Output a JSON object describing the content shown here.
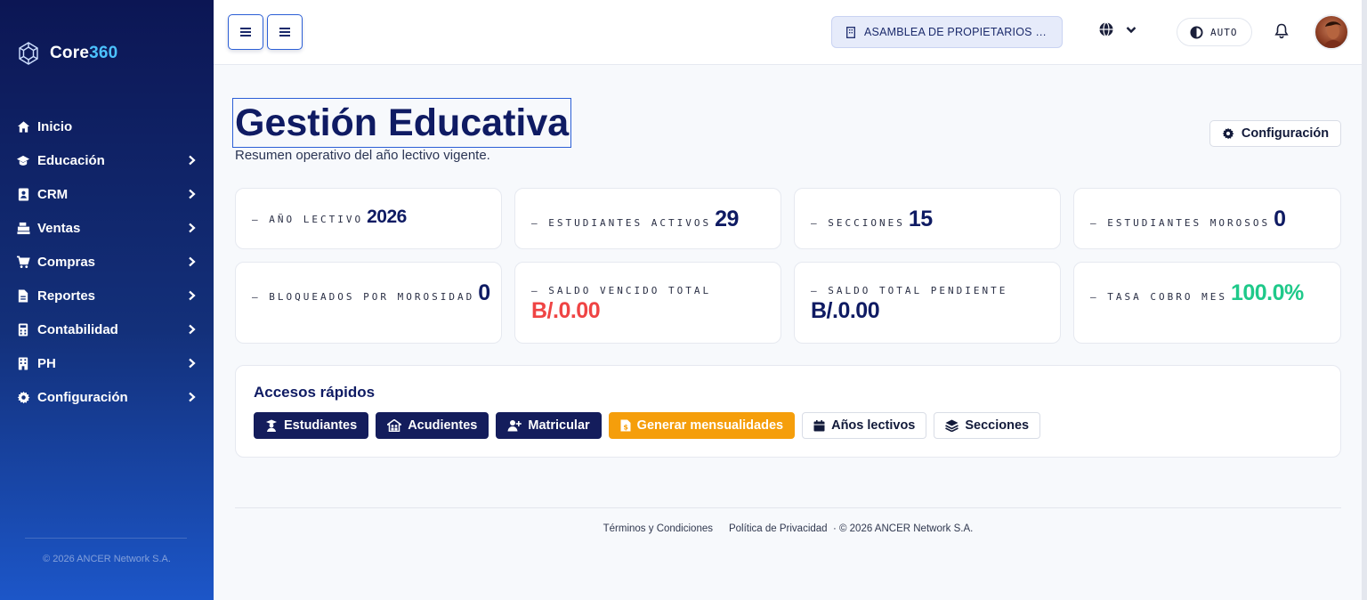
{
  "brand": {
    "name_prefix": "Core",
    "name_suffix": "360"
  },
  "sidebar": {
    "items": [
      {
        "label": "Inicio",
        "icon": "home-icon"
      },
      {
        "label": "Educación",
        "icon": "graduation-cap-icon"
      },
      {
        "label": "CRM",
        "icon": "contact-card-icon"
      },
      {
        "label": "Ventas",
        "icon": "cash-register-icon"
      },
      {
        "label": "Compras",
        "icon": "cart-icon"
      },
      {
        "label": "Reportes",
        "icon": "report-file-icon"
      },
      {
        "label": "Contabilidad",
        "icon": "calculator-icon"
      },
      {
        "label": "PH",
        "icon": "building-icon"
      },
      {
        "label": "Configuración",
        "icon": "gear-icon"
      }
    ],
    "footer": "© 2026 ANCER Network S.A."
  },
  "topbar": {
    "organization": "ASAMBLEA DE PROPIETARIOS DE ...",
    "theme_label": "AUTO"
  },
  "page": {
    "title": "Gestión Educativa",
    "subtitle": "Resumen operativo del año lectivo vigente.",
    "config_button": "Configuración"
  },
  "kpis": [
    {
      "label": "— AÑO LECTIVO",
      "value": "2026"
    },
    {
      "label": "— ESTUDIANTES ACTIVOS",
      "value": "29"
    },
    {
      "label": "— SECCIONES",
      "value": "15"
    },
    {
      "label": "— ESTUDIANTES MOROSOS",
      "value": "0"
    },
    {
      "label": "— BLOQUEADOS POR MOROSIDAD",
      "value": "0"
    },
    {
      "label": "— SALDO VENCIDO TOTAL",
      "value": "B/.0.00"
    },
    {
      "label": "— SALDO TOTAL PENDIENTE",
      "value": "B/.0.00"
    },
    {
      "label": "— TASA COBRO MES",
      "value": "100.0%"
    }
  ],
  "quick_access": {
    "title": "Accesos rápidos",
    "buttons": [
      "Estudiantes",
      "Acudientes",
      "Matricular",
      "Generar mensualidades",
      "Años lectivos",
      "Secciones"
    ]
  },
  "footer": {
    "terms": "Términos y Condiciones",
    "privacy": "Política de Privacidad",
    "copyright": "· © 2026 ANCER Network S.A."
  },
  "colors": {
    "accent": "#2c5fd6",
    "danger": "#ef4444",
    "success": "#1fc98a",
    "warning": "#f59e0b",
    "navy": "#141d5c"
  }
}
